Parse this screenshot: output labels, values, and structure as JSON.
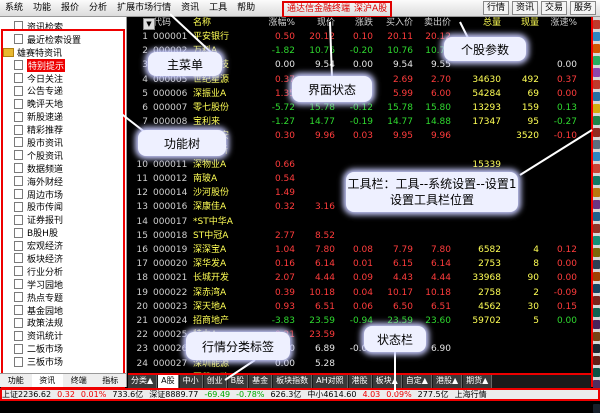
{
  "menu": {
    "left": [
      "系统",
      "功能",
      "报价",
      "分析",
      "扩展市场行情",
      "资讯",
      "工具",
      "帮助"
    ],
    "middle": [
      "通达信金融终端",
      "深沪A股"
    ],
    "right": [
      "行情",
      "资讯",
      "交易",
      "服务"
    ]
  },
  "tree": [
    {
      "label": "资讯检索",
      "level": "child"
    },
    {
      "label": "最近检索设置",
      "level": "child"
    },
    {
      "label": "雄赛特资讯",
      "level": "folder"
    },
    {
      "label": "特别提示",
      "level": "child",
      "selected": true
    },
    {
      "label": "今日关注",
      "level": "child"
    },
    {
      "label": "公告专递",
      "level": "child"
    },
    {
      "label": "晚评天地",
      "level": "child"
    },
    {
      "label": "新股速递",
      "level": "child"
    },
    {
      "label": "精彩推荐",
      "level": "child"
    },
    {
      "label": "股市资讯",
      "level": "child"
    },
    {
      "label": "个股资讯",
      "level": "child"
    },
    {
      "label": "数据频道",
      "level": "child"
    },
    {
      "label": "海外财经",
      "level": "child"
    },
    {
      "label": "周边市场",
      "level": "child"
    },
    {
      "label": "股市传闻",
      "level": "child"
    },
    {
      "label": "证券报刊",
      "level": "child"
    },
    {
      "label": "B股H股",
      "level": "child"
    },
    {
      "label": "宏观经济",
      "level": "child"
    },
    {
      "label": "板块经济",
      "level": "child"
    },
    {
      "label": "行业分析",
      "level": "child"
    },
    {
      "label": "学习园地",
      "level": "child"
    },
    {
      "label": "热点专题",
      "level": "child"
    },
    {
      "label": "基金园地",
      "level": "child"
    },
    {
      "label": "政策法规",
      "level": "child"
    },
    {
      "label": "资讯统计",
      "level": "child"
    },
    {
      "label": "二板市场",
      "level": "child"
    },
    {
      "label": "三板市场",
      "level": "child"
    }
  ],
  "left_tabs": [
    {
      "label": "功能",
      "active": false
    },
    {
      "label": "资讯",
      "active": true
    },
    {
      "label": "终端",
      "active": false
    },
    {
      "label": "指标",
      "active": false
    }
  ],
  "columns": [
    "代码",
    "名称",
    "涨幅%",
    "现价",
    "涨跌",
    "买入价",
    "卖出价",
    "总量",
    "现量",
    "涨速%"
  ],
  "rows": [
    {
      "idx": "1",
      "code": "000001",
      "name": "平安银行",
      "pct": "0.50",
      "now": "20.12",
      "chg": "0.10",
      "buy": "20.11",
      "sell": "20.12",
      "vol": "",
      "cur": "",
      "spd": "",
      "d": "up"
    },
    {
      "idx": "2",
      "code": "000002",
      "name": "万科A",
      "pct": "-1.82",
      "now": "10.76",
      "chg": "-0.20",
      "buy": "10.76",
      "sell": "10.77",
      "vol": "",
      "cur": "",
      "spd": "",
      "d": "dn"
    },
    {
      "idx": "3",
      "code": "000004",
      "name": "国农科技",
      "pct": "0.00",
      "now": "9.54",
      "chg": "0.00",
      "buy": "9.54",
      "sell": "9.55",
      "vol": "",
      "cur": "",
      "spd": "0.00",
      "d": "fl"
    },
    {
      "idx": "4",
      "code": "000005",
      "name": "世纪星源",
      "pct": "0.37",
      "now": "",
      "chg": "",
      "buy": "2.69",
      "sell": "2.70",
      "vol": "34630",
      "cur": "492",
      "spd": "0.37",
      "d": "up"
    },
    {
      "idx": "5",
      "code": "000006",
      "name": "深振业A",
      "pct": "1.35",
      "now": "",
      "chg": "",
      "buy": "5.99",
      "sell": "6.00",
      "vol": "54284",
      "cur": "69",
      "spd": "0.00",
      "d": "up"
    },
    {
      "idx": "6",
      "code": "000007",
      "name": "零七股份",
      "pct": "-5.72",
      "now": "15.78",
      "chg": "-0.12",
      "buy": "15.78",
      "sell": "15.80",
      "vol": "13293",
      "cur": "159",
      "spd": "0.13",
      "d": "dn"
    },
    {
      "idx": "7",
      "code": "000008",
      "name": "宝利来",
      "pct": "-1.27",
      "now": "14.77",
      "chg": "-0.19",
      "buy": "14.77",
      "sell": "14.88",
      "vol": "17347",
      "cur": "95",
      "spd": "-0.27",
      "d": "dn"
    },
    {
      "idx": "8",
      "code": "000009",
      "name": "中国宝安",
      "pct": "0.30",
      "now": "9.96",
      "chg": "0.03",
      "buy": "9.95",
      "sell": "9.96",
      "vol": "",
      "cur": "3520",
      "spd": "-0.10",
      "d": "up"
    },
    {
      "idx": "9",
      "code": "000010",
      "name": "SST华新",
      "pct": "",
      "now": "",
      "chg": "",
      "buy": "",
      "sell": "",
      "vol": "",
      "cur": "",
      "spd": "",
      "d": "fl"
    },
    {
      "idx": "10",
      "code": "000011",
      "name": "深物业A",
      "pct": "0.66",
      "now": "",
      "chg": "",
      "buy": "",
      "sell": "",
      "vol": "15339",
      "cur": "",
      "spd": "",
      "d": "up"
    },
    {
      "idx": "11",
      "code": "000012",
      "name": "南玻A",
      "pct": "0.54",
      "now": "",
      "chg": "",
      "buy": "",
      "sell": "",
      "vol": "",
      "cur": "",
      "spd": "",
      "d": "up"
    },
    {
      "idx": "12",
      "code": "000014",
      "name": "沙河股份",
      "pct": "1.49",
      "now": "",
      "chg": "",
      "buy": "",
      "sell": "",
      "vol": "",
      "cur": "",
      "spd": "",
      "d": "up"
    },
    {
      "idx": "13",
      "code": "000016",
      "name": "深康佳A",
      "pct": "0.32",
      "now": "3.16",
      "chg": "",
      "buy": "",
      "sell": "",
      "vol": "",
      "cur": "",
      "spd": "",
      "d": "up"
    },
    {
      "idx": "14",
      "code": "000017",
      "name": "*ST中华A",
      "pct": "",
      "now": "",
      "chg": "",
      "buy": "",
      "sell": "",
      "vol": "",
      "cur": "",
      "spd": "",
      "d": "fl"
    },
    {
      "idx": "15",
      "code": "000018",
      "name": "ST中冠A",
      "pct": "2.77",
      "now": "8.52",
      "chg": "",
      "buy": "",
      "sell": "",
      "vol": "",
      "cur": "",
      "spd": "",
      "d": "up"
    },
    {
      "idx": "16",
      "code": "000019",
      "name": "深深宝A",
      "pct": "1.04",
      "now": "7.80",
      "chg": "0.08",
      "buy": "7.79",
      "sell": "7.80",
      "vol": "6582",
      "cur": "4",
      "spd": "0.12",
      "d": "up"
    },
    {
      "idx": "17",
      "code": "000020",
      "name": "深华发A",
      "pct": "0.16",
      "now": "6.14",
      "chg": "0.01",
      "buy": "6.15",
      "sell": "6.14",
      "vol": "2753",
      "cur": "8",
      "spd": "0.00",
      "d": "up"
    },
    {
      "idx": "18",
      "code": "000021",
      "name": "长城开发",
      "pct": "2.07",
      "now": "4.44",
      "chg": "0.09",
      "buy": "4.43",
      "sell": "4.44",
      "vol": "33968",
      "cur": "90",
      "spd": "0.00",
      "d": "up"
    },
    {
      "idx": "19",
      "code": "000022",
      "name": "深赤湾A",
      "pct": "0.39",
      "now": "10.18",
      "chg": "0.04",
      "buy": "10.17",
      "sell": "10.18",
      "vol": "2758",
      "cur": "2",
      "spd": "-0.09",
      "d": "up"
    },
    {
      "idx": "20",
      "code": "000023",
      "name": "深天地A",
      "pct": "0.93",
      "now": "6.51",
      "chg": "0.06",
      "buy": "6.50",
      "sell": "6.51",
      "vol": "4562",
      "cur": "30",
      "spd": "0.15",
      "d": "up"
    },
    {
      "idx": "21",
      "code": "000024",
      "name": "招商地产",
      "pct": "-3.83",
      "now": "23.59",
      "chg": "-0.94",
      "buy": "23.59",
      "sell": "23.60",
      "vol": "59702",
      "cur": "5",
      "spd": "0.00",
      "d": "dn"
    },
    {
      "idx": "22",
      "code": "000025",
      "name": "特力A",
      "pct": "0.21",
      "now": "23.59",
      "chg": "",
      "buy": "",
      "sell": "",
      "vol": "",
      "cur": "",
      "spd": "",
      "d": "up"
    },
    {
      "idx": "23",
      "code": "000026",
      "name": "飞亚达A",
      "pct": "0.00",
      "now": "6.89",
      "chg": "-0.09",
      "buy": "6.89",
      "sell": "6.90",
      "vol": "",
      "cur": "",
      "spd": "",
      "d": "fl"
    },
    {
      "idx": "24",
      "code": "000027",
      "name": "深圳能源",
      "pct": "0.00",
      "now": "5.28",
      "chg": "",
      "buy": "",
      "sell": "",
      "vol": "",
      "cur": "",
      "spd": "",
      "d": "fl"
    },
    {
      "idx": "25",
      "code": "000028",
      "name": "国药一致",
      "pct": "-0.33",
      "now": "5.28",
      "chg": "",
      "buy": "",
      "sell": "",
      "vol": "",
      "cur": "",
      "spd": "",
      "d": "dn"
    }
  ],
  "category_tabs": [
    {
      "label": "分类▲",
      "active": false
    },
    {
      "label": "A股",
      "active": true
    },
    {
      "label": "中小",
      "active": false
    },
    {
      "label": "创业",
      "active": false
    },
    {
      "label": "B股",
      "active": false
    },
    {
      "label": "基金",
      "active": false
    },
    {
      "label": "板块指数",
      "active": false
    },
    {
      "label": "AH对照",
      "active": false
    },
    {
      "label": "港股",
      "active": false
    },
    {
      "label": "板块▲",
      "active": false
    },
    {
      "label": "自定▲",
      "active": false
    },
    {
      "label": "港股▲",
      "active": false
    },
    {
      "label": "期货▲",
      "active": false
    }
  ],
  "status_bar": [
    {
      "text": "上证2236.62",
      "color": "#000"
    },
    {
      "text": "0.32",
      "color": "#e00"
    },
    {
      "text": "0.01%",
      "color": "#e00"
    },
    {
      "text": "733.6亿",
      "color": "#000"
    },
    {
      "text": "深证8889.77",
      "color": "#000"
    },
    {
      "text": "-69.49",
      "color": "#0a0"
    },
    {
      "text": "-0.78%",
      "color": "#0a0"
    },
    {
      "text": "626.3亿",
      "color": "#000"
    },
    {
      "text": "中小4614.60",
      "color": "#000"
    },
    {
      "text": "4.03",
      "color": "#e00"
    },
    {
      "text": "0.09%",
      "color": "#e00"
    },
    {
      "text": "277.5亿",
      "color": "#000"
    },
    {
      "text": "上海行情",
      "color": "#000"
    }
  ],
  "callouts": {
    "main_menu": "主菜单",
    "ui_state": "界面状态",
    "stock_params": "个股参数",
    "function_tree": "功能树",
    "toolbar": "工具栏：工具--系统设置--设置1\n设置工具栏位置",
    "category_tabs": "行情分类标签",
    "status_bar": "状态栏"
  },
  "sort_button": "▼",
  "toolbar_colors": [
    "#c0392b",
    "#2e86c1",
    "#d35400",
    "#27ae60",
    "#8e44ad",
    "#c0392b",
    "#2471a3",
    "#d4ac0d",
    "#1e8449",
    "#922b21",
    "#5d6d7e",
    "#2e86c1",
    "#cb4335",
    "#117a65",
    "#b9770e",
    "#6c3483",
    "#1f618d",
    "#943126",
    "#148f77",
    "#7d6608",
    "#2e4053",
    "#a04000",
    "#154360",
    "#7b241c",
    "#0e6251",
    "#4a235a",
    "#784212",
    "#1b2631",
    "#641e16",
    "#0b5345",
    "#512e5f",
    "#6e2c00",
    "#17202a"
  ]
}
